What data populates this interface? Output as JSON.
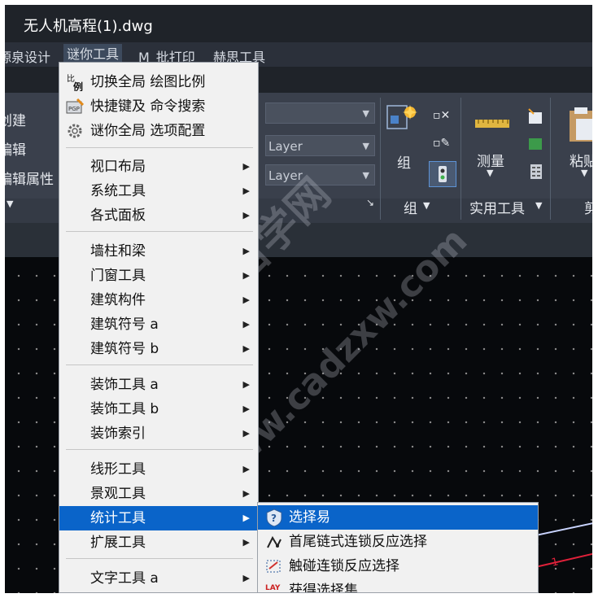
{
  "window": {
    "title": "无人机高程(1).dwg"
  },
  "menubar": {
    "items": [
      "源泉设计",
      "谜你工具",
      "M_批打印",
      "赫思工具"
    ],
    "active_index": 1
  },
  "ribbon": {
    "left_labels": [
      "创建",
      "编辑",
      "编辑属性"
    ],
    "layer_fields": [
      "Layer",
      "Layer"
    ],
    "group_button_label": "组",
    "group_panel_label": "组",
    "measure_label": "测量",
    "utilities_panel_label": "实用工具",
    "paste_label": "粘贴",
    "clipboard_panel_partial": "剪"
  },
  "dropdown": {
    "items": [
      {
        "label": "切换全局 绘图比例",
        "icon": "scale-icon"
      },
      {
        "label": "快捷键及 命令搜索",
        "icon": "keyboard-search-icon"
      },
      {
        "label": "谜你全局 选项配置",
        "icon": "gear-icon"
      },
      {
        "label": "视口布局",
        "submenu": true
      },
      {
        "label": "系统工具",
        "submenu": true
      },
      {
        "label": "各式面板",
        "submenu": true
      },
      {
        "label": "墙柱和梁",
        "submenu": true
      },
      {
        "label": "门窗工具",
        "submenu": true
      },
      {
        "label": "建筑构件",
        "submenu": true
      },
      {
        "label": "建筑符号 a",
        "submenu": true
      },
      {
        "label": "建筑符号 b",
        "submenu": true
      },
      {
        "label": "装饰工具 a",
        "submenu": true
      },
      {
        "label": "装饰工具 b",
        "submenu": true
      },
      {
        "label": "装饰索引",
        "submenu": true
      },
      {
        "label": "线形工具",
        "submenu": true
      },
      {
        "label": "景观工具",
        "submenu": true
      },
      {
        "label": "统计工具",
        "submenu": true,
        "highlighted": true
      },
      {
        "label": "扩展工具",
        "submenu": true
      },
      {
        "label": "文字工具 a",
        "submenu": true
      }
    ]
  },
  "submenu": {
    "items": [
      {
        "label": "选择易",
        "icon": "question-shield-icon",
        "selected": true
      },
      {
        "label": "首尾链式连锁反应选择",
        "icon": "chain-select-icon"
      },
      {
        "label": "触碰连锁反应选择",
        "icon": "touch-select-icon"
      },
      {
        "label": "获得选择集",
        "icon": "lay-icon"
      }
    ]
  },
  "canvas": {
    "marker_text": "1"
  },
  "watermark": {
    "line1": "CAD自学网",
    "line2": "www.cadzxw.com"
  },
  "colors": {
    "highlight": "#0a64c9",
    "menu_bg": "#f1f1f1",
    "canvas_bg": "#07090c",
    "ribbon_bg": "#3a404c"
  }
}
